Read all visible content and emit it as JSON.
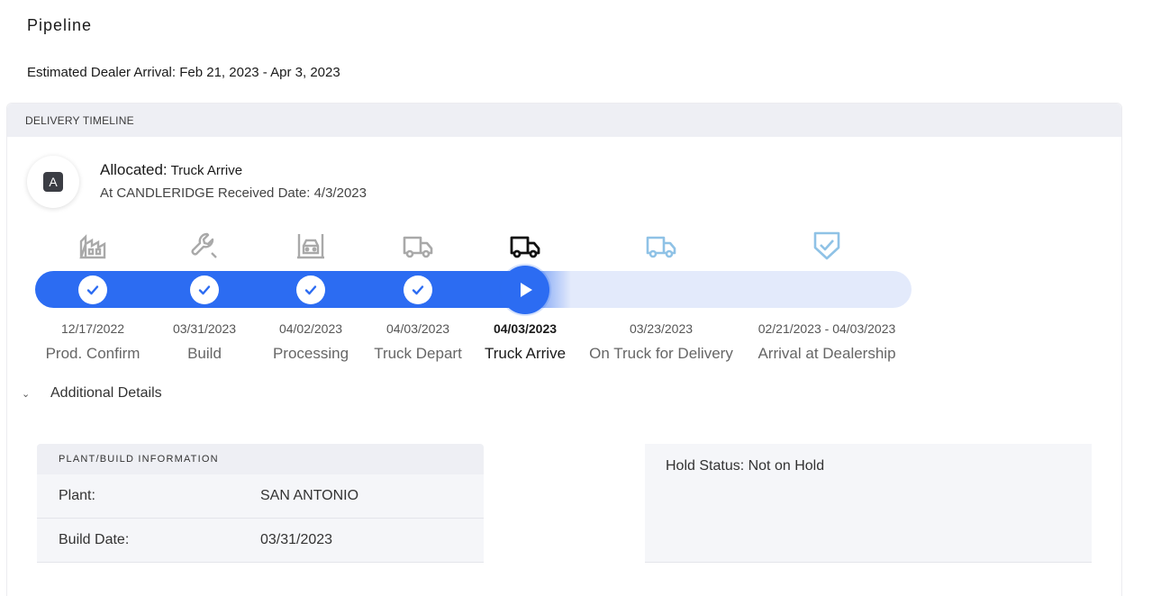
{
  "page": {
    "title": "Pipeline",
    "estimated_arrival": "Estimated Dealer Arrival: Feb 21, 2023 - Apr 3, 2023"
  },
  "timeline": {
    "header": "DELIVERY TIMELINE",
    "status": {
      "avatar_letter": "A",
      "state": "Allocated:",
      "stage": "Truck Arrive",
      "subtitle": "At CANDLERIDGE Received Date: 4/3/2023"
    },
    "progress_fraction": 0.6,
    "stages": [
      {
        "label": "Prod. Confirm",
        "date": "12/17/2022",
        "icon": "factory-icon",
        "state": "complete"
      },
      {
        "label": "Build",
        "date": "03/31/2023",
        "icon": "wrench-icon",
        "state": "complete"
      },
      {
        "label": "Processing",
        "date": "04/02/2023",
        "icon": "processing-icon",
        "state": "complete"
      },
      {
        "label": "Truck Depart",
        "date": "04/03/2023",
        "icon": "truck-icon",
        "state": "complete"
      },
      {
        "label": "Truck Arrive",
        "date": "04/03/2023",
        "icon": "truck-icon",
        "state": "current"
      },
      {
        "label": "On Truck for Delivery",
        "date": "03/23/2023",
        "icon": "truck-icon",
        "state": "upcoming"
      },
      {
        "label": "Arrival at Dealership",
        "date": "02/21/2023 - 04/03/2023",
        "icon": "shield-check-icon",
        "state": "upcoming"
      }
    ],
    "colors": {
      "accent": "#2c6cf2",
      "track": "#e3eafb",
      "complete_icon": "#a9a9a9",
      "upcoming_icon": "#8fc2e6"
    }
  },
  "details": {
    "toggle_label": "Additional Details",
    "plant": {
      "header": "PLANT/BUILD INFORMATION",
      "rows": [
        {
          "key": "Plant:",
          "value": "SAN ANTONIO"
        },
        {
          "key": "Build Date:",
          "value": "03/31/2023"
        }
      ]
    },
    "hold_status": "Hold Status: Not on Hold"
  }
}
